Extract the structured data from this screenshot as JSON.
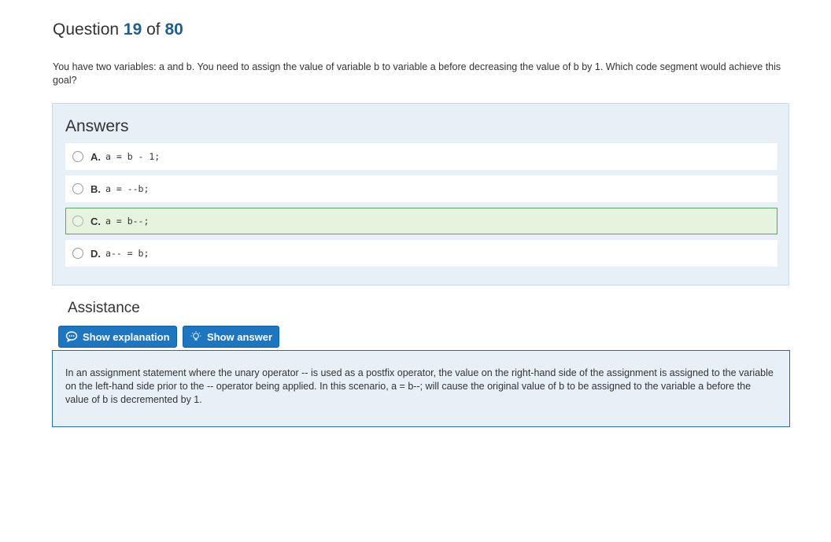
{
  "question": {
    "prefix": "Question",
    "number": "19",
    "of_label": "of",
    "total": "80",
    "text": "You have two variables: a and b. You need to assign the value of variable b to variable a before decreasing the value of b by 1. Which code segment would achieve this goal?"
  },
  "answers": {
    "title": "Answers",
    "options": [
      {
        "letter": "A.",
        "code": "a = b - 1;"
      },
      {
        "letter": "B.",
        "code": "a = --b;"
      },
      {
        "letter": "C.",
        "code": "a = b--;",
        "highlighted": true
      },
      {
        "letter": "D.",
        "code": "a-- = b;"
      }
    ]
  },
  "assistance": {
    "title": "Assistance",
    "show_explanation_label": "Show explanation",
    "show_answer_label": "Show answer",
    "explanation_text": "In an assignment statement where the unary operator -- is used as a postfix operator, the value on the right-hand side of the assignment is assigned to the variable on the left-hand side prior to the -- operator being applied. In this scenario, a = b--; will cause the original value of b to be assigned to the variable a before the value of b is decremented by 1."
  },
  "colors": {
    "accent": "#1f76c0",
    "question_number": "#1f5f8b",
    "panel_bg": "#e7f0f7",
    "correct_bg": "#e5f3df",
    "correct_border": "#5aa85a"
  },
  "icons": {
    "explanation": "speech-bubble-icon",
    "answer": "lightbulb-icon"
  }
}
